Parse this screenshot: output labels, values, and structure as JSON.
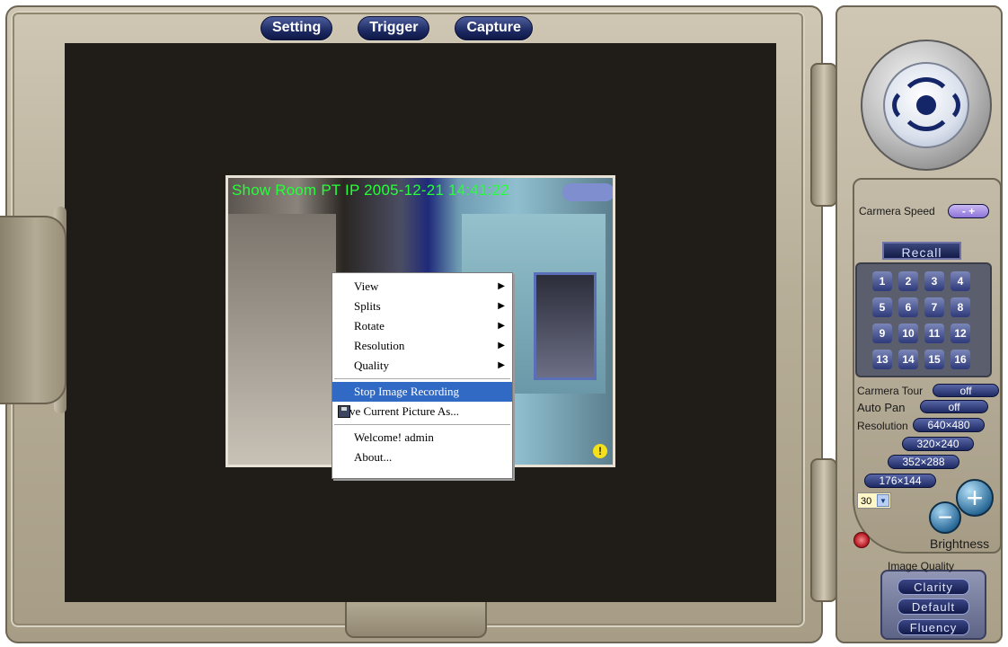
{
  "top_tabs": [
    "Setting",
    "Trigger",
    "Capture"
  ],
  "viewport": {
    "overlay_title": "Show Room PT IP  2005-12-21  14:41:22",
    "warning_glyph": "!"
  },
  "context_menu": {
    "items": [
      {
        "label": "View",
        "submenu": "▶"
      },
      {
        "label": "Splits",
        "submenu": "▶"
      },
      {
        "label": "Rotate",
        "submenu": "▶"
      },
      {
        "label": "Resolution",
        "submenu": "▶"
      },
      {
        "label": "Quality",
        "submenu": "▶"
      }
    ],
    "stop_recording": "Stop Image Recording",
    "save_picture": "Save Current Picture As...",
    "welcome": "Welcome! admin",
    "about": "About..."
  },
  "panel": {
    "camera_speed_label": "Carmera Speed",
    "speed_controls": "- +",
    "recall_label": "Recall",
    "presets": [
      "1",
      "2",
      "3",
      "4",
      "5",
      "6",
      "7",
      "8",
      "9",
      "10",
      "11",
      "12",
      "13",
      "14",
      "15",
      "16"
    ],
    "camera_tour_label": "Carmera Tour",
    "camera_tour_value": "off",
    "auto_pan_label": "Auto Pan",
    "auto_pan_value": "off",
    "resolution_label": "Resolution",
    "resolutions": [
      "640×480",
      "320×240",
      "352×288",
      "176×144"
    ],
    "frame_rate_value": "30",
    "brightness_label": "Brightness",
    "brightness_minus": "−",
    "brightness_plus": "+",
    "image_quality_label": "Image Quality",
    "image_quality_options": [
      "Clarity",
      "Default",
      "Fluency"
    ]
  },
  "colors": {
    "menu_highlight": "#316ac5",
    "overlay_text": "#27ff3a",
    "pill_blue": "#1d2a63"
  }
}
